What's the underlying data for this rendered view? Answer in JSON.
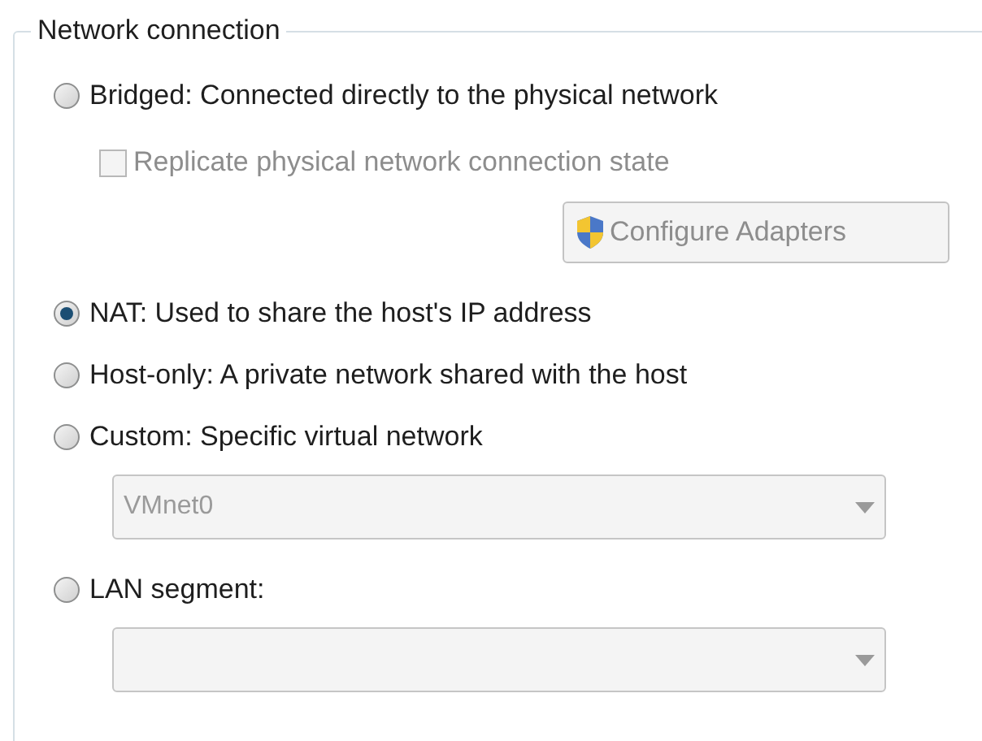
{
  "group": {
    "title": "Network connection"
  },
  "items": [
    {
      "kind": "radio",
      "label": "Bridged: Connected directly to the physical network",
      "selected": false
    },
    {
      "kind": "checkbox",
      "label": "Replicate physical network connection state",
      "checked": false,
      "disabled": true
    },
    {
      "kind": "button",
      "label": "Configure Adapters",
      "disabled": true
    },
    {
      "kind": "radio",
      "label": "NAT: Used to share the host's IP address",
      "selected": true
    },
    {
      "kind": "radio",
      "label": "Host-only: A private network shared with the host",
      "selected": false
    },
    {
      "kind": "radio",
      "label": "Custom: Specific virtual network",
      "selected": false
    },
    {
      "kind": "dropdown",
      "value": "VMnet0",
      "disabled": true
    },
    {
      "kind": "radio",
      "label": "LAN segment:",
      "selected": false
    },
    {
      "kind": "dropdown",
      "disabled": true
    }
  ]
}
